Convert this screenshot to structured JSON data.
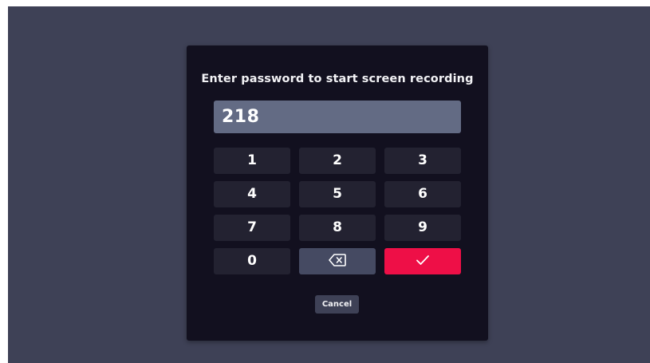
{
  "dialog": {
    "title": "Enter password to start screen recording",
    "password_value": "218",
    "keys": {
      "k1": "1",
      "k2": "2",
      "k3": "3",
      "k4": "4",
      "k5": "5",
      "k6": "6",
      "k7": "7",
      "k8": "8",
      "k9": "9",
      "k0": "0"
    },
    "backspace_icon": "backspace-icon",
    "confirm_icon": "checkmark-icon",
    "cancel_label": "Cancel"
  },
  "colors": {
    "backdrop": "#3e4156",
    "dialog_bg": "#12101f",
    "field_bg": "#636b84",
    "key_bg": "#232231",
    "backspace_bg": "#454a62",
    "confirm_bg": "#ee0f47"
  }
}
